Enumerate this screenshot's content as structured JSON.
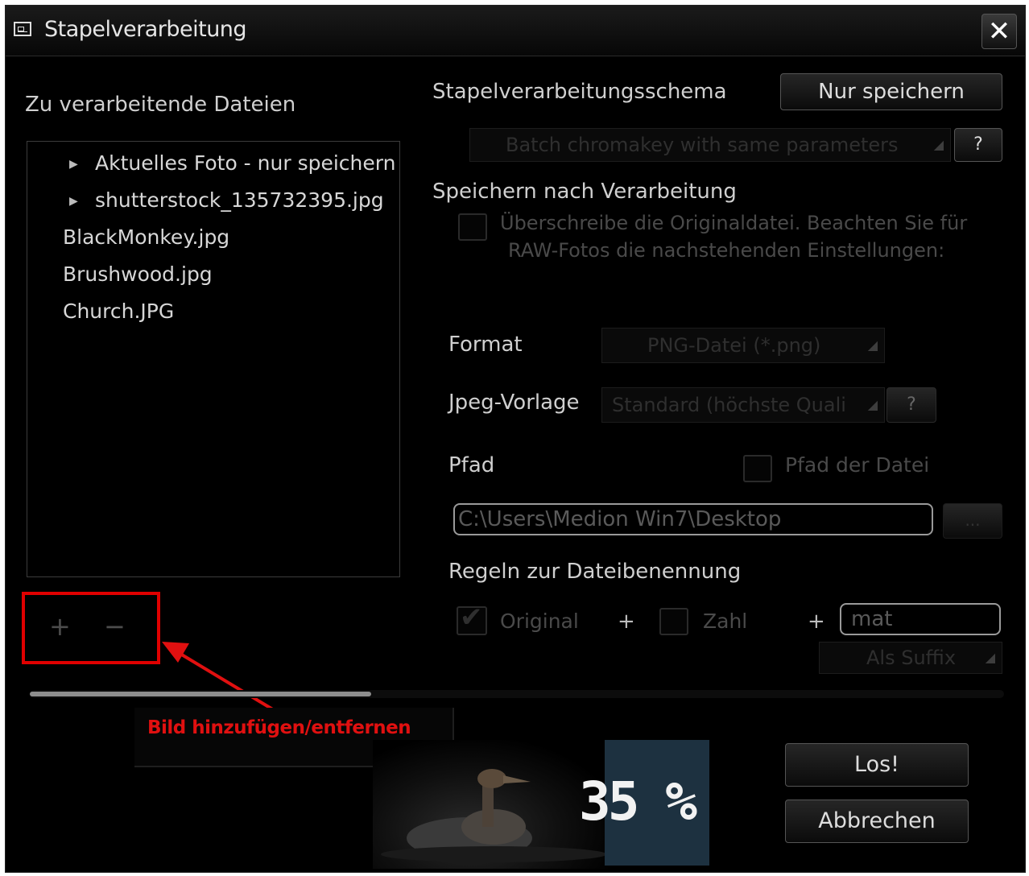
{
  "window": {
    "title": "Stapelverarbeitung",
    "close_glyph": "✕"
  },
  "files": {
    "label": "Zu verarbeitende Dateien",
    "items": [
      {
        "label": "Aktuelles Foto - nur speichern",
        "expandable": true
      },
      {
        "label": "shutterstock_135732395.jpg",
        "expandable": true
      },
      {
        "label": "BlackMonkey.jpg",
        "expandable": false
      },
      {
        "label": "Brushwood.jpg",
        "expandable": false
      },
      {
        "label": "Church.JPG",
        "expandable": false
      }
    ],
    "add_glyph": "+",
    "remove_glyph": "−"
  },
  "schema": {
    "label": "Stapelverarbeitungsschema",
    "save_only_button": "Nur speichern",
    "selected": "Batch chromakey with same parameters",
    "help": "?"
  },
  "save_after": {
    "label": "Speichern nach Verarbeitung",
    "overwrite_text_line1": "Überschreibe die Originaldatei. Beachten Sie für",
    "overwrite_text_line2": "RAW-Fotos die nachstehenden Einstellungen:"
  },
  "format": {
    "label": "Format",
    "value": "PNG-Datei (*.png)"
  },
  "jpeg": {
    "label": "Jpeg-Vorlage",
    "value": "Standard (höchste Quali",
    "help": "?"
  },
  "path": {
    "label": "Pfad",
    "file_path_checkbox": "Pfad der Datei",
    "value": "C:\\Users\\Medion Win7\\Desktop",
    "browse": "..."
  },
  "naming": {
    "label": "Regeln zur Dateibenennung",
    "original": "Original",
    "plus1": "+",
    "number": "Zahl",
    "plus2": "+",
    "suffix_value": "mat",
    "suffix_mode": "Als Suffix"
  },
  "progress": {
    "percent_text": "35 %",
    "fraction": 0.35
  },
  "actions": {
    "start": "Los!",
    "cancel": "Abbrechen"
  },
  "annotation": {
    "text": "Bild hinzufügen/entfernen",
    "color": "#e01010"
  }
}
